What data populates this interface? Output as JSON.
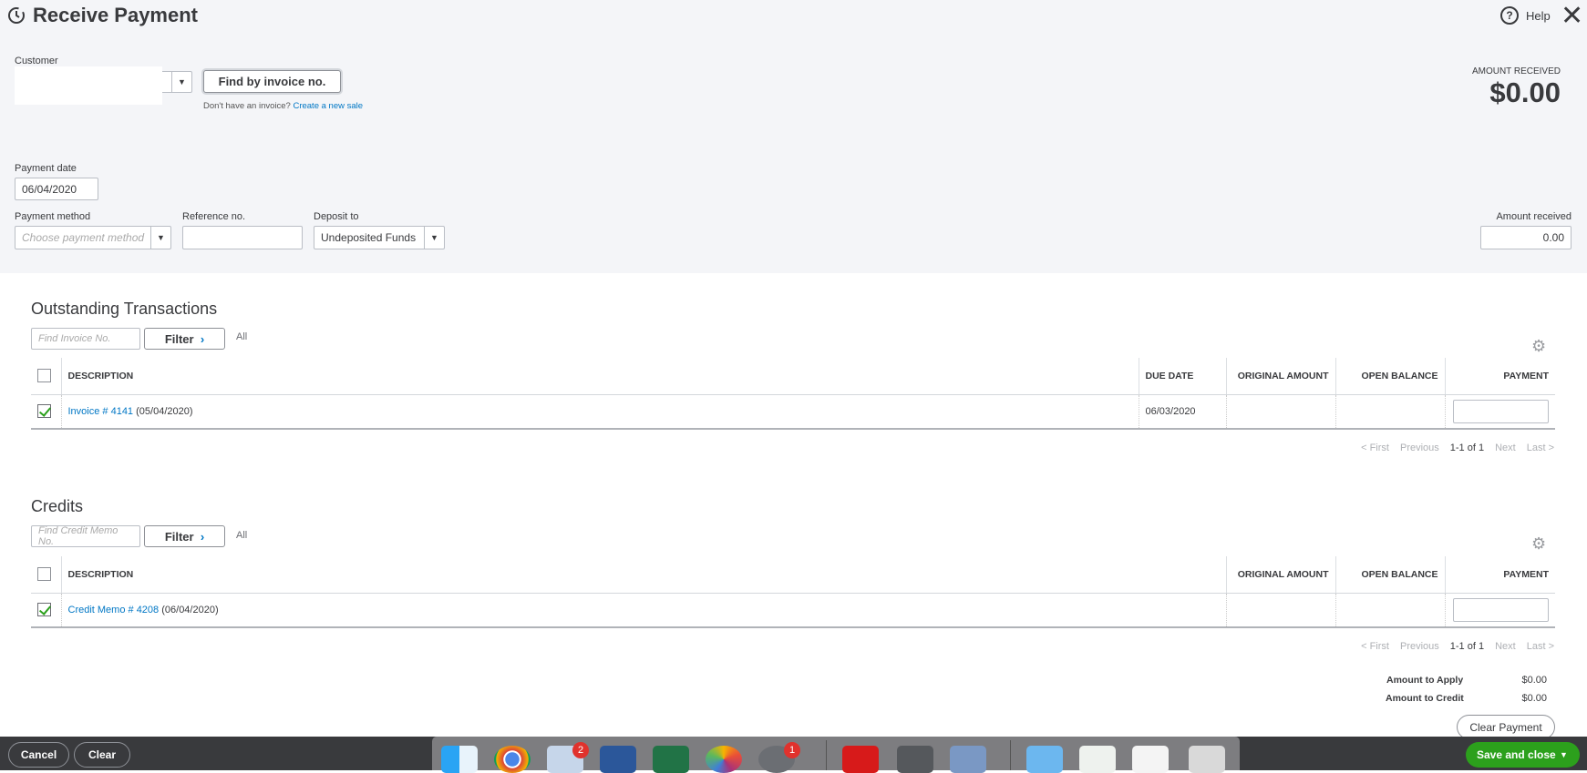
{
  "header": {
    "title": "Receive Payment",
    "help": "Help"
  },
  "customer": {
    "label": "Customer",
    "value": "",
    "find_button": "Find by invoice no.",
    "no_invoice_text": "Don't have an invoice?",
    "create_link": "Create a new sale"
  },
  "amount_received_summary": {
    "label": "AMOUNT RECEIVED",
    "value": "$0.00"
  },
  "payment_date": {
    "label": "Payment date",
    "value": "06/04/2020"
  },
  "payment_method": {
    "label": "Payment method",
    "placeholder": "Choose payment method"
  },
  "reference": {
    "label": "Reference no.",
    "value": ""
  },
  "deposit_to": {
    "label": "Deposit to",
    "value": "Undeposited Funds"
  },
  "amount_received": {
    "label": "Amount received",
    "value": "0.00"
  },
  "outstanding": {
    "title": "Outstanding Transactions",
    "search_placeholder": "Find Invoice No.",
    "filter": "Filter",
    "all": "All",
    "columns": [
      "DESCRIPTION",
      "DUE DATE",
      "ORIGINAL AMOUNT",
      "OPEN BALANCE",
      "PAYMENT"
    ],
    "rows": [
      {
        "link": "Invoice # 4141",
        "date": "(05/04/2020)",
        "due": "06/03/2020",
        "checked": true
      }
    ],
    "pagination": {
      "first": "< First",
      "previous": "Previous",
      "range": "1-1 of 1",
      "next": "Next",
      "last": "Last >"
    }
  },
  "credits": {
    "title": "Credits",
    "search_placeholder": "Find Credit Memo No.",
    "filter": "Filter",
    "all": "All",
    "columns": [
      "DESCRIPTION",
      "ORIGINAL AMOUNT",
      "OPEN BALANCE",
      "PAYMENT"
    ],
    "rows": [
      {
        "link": "Credit Memo # 4208",
        "date": "(06/04/2020)",
        "checked": true
      }
    ],
    "pagination": {
      "first": "< First",
      "previous": "Previous",
      "range": "1-1 of 1",
      "next": "Next",
      "last": "Last >"
    }
  },
  "totals": {
    "apply_label": "Amount to Apply",
    "apply_value": "$0.00",
    "credit_label": "Amount to Credit",
    "credit_value": "$0.00",
    "clear_payment": "Clear Payment"
  },
  "footer": {
    "cancel": "Cancel",
    "clear": "Clear",
    "save": "Save and close"
  },
  "dock": {
    "mail_badge": "2",
    "prefs_badge": "1"
  },
  "colors": {
    "accent": "#0077c5",
    "save": "#2ca01c",
    "footer": "#393a3d"
  }
}
